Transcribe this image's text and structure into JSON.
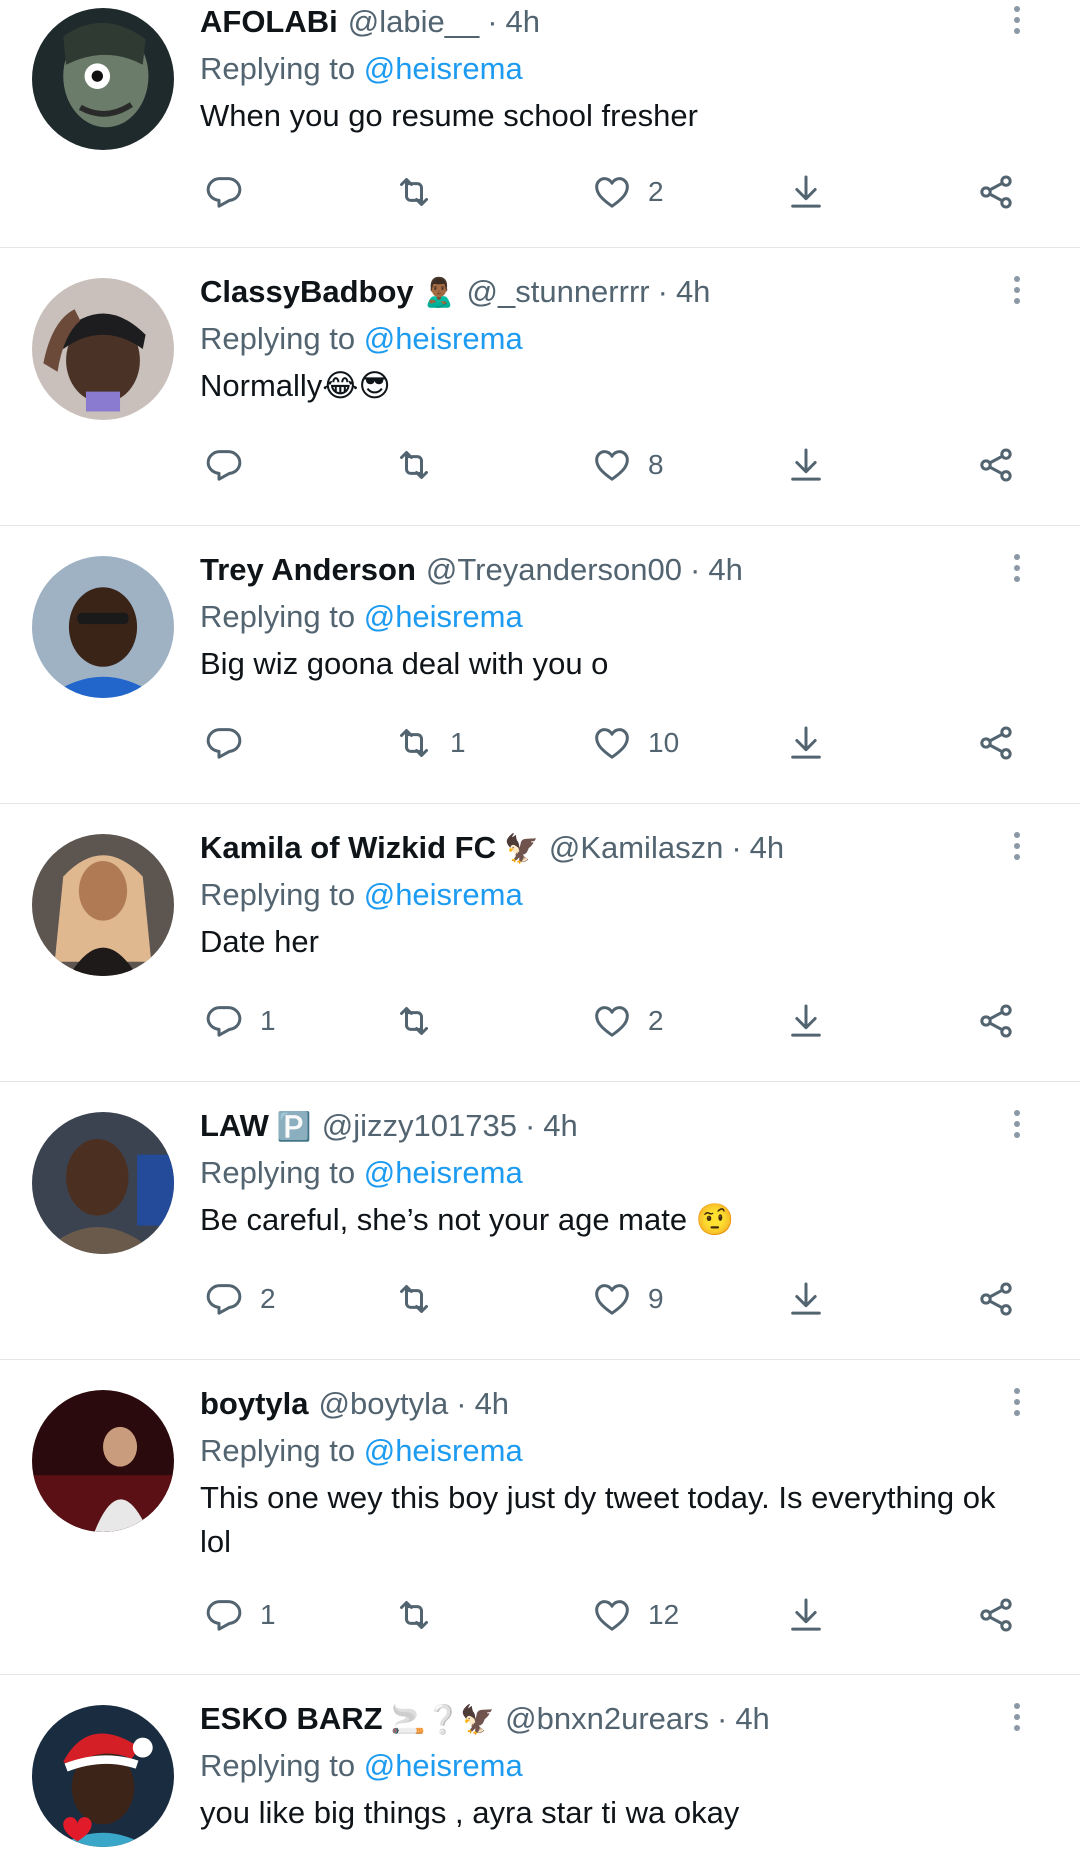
{
  "tweets": [
    {
      "name": "AFOLABi",
      "badge": "",
      "handle": "@labie__",
      "time": "4h",
      "replying_prefix": "Replying to",
      "replying_to": "@heisrema",
      "text": "When you go resume school fresher",
      "replies": "",
      "retweets": "",
      "likes": "2"
    },
    {
      "name": "ClassyBadboy",
      "badge": "🙎🏾‍♂️",
      "handle": "@_stunnerrrr",
      "time": "4h",
      "replying_prefix": "Replying to",
      "replying_to": "@heisrema",
      "text": "Normally😂😎",
      "replies": "",
      "retweets": "",
      "likes": "8"
    },
    {
      "name": "Trey Anderson",
      "badge": "",
      "handle": "@Treyanderson00",
      "time": "4h",
      "replying_prefix": "Replying to",
      "replying_to": "@heisrema",
      "text": "Big wiz goona deal with you o",
      "replies": "",
      "retweets": "1",
      "likes": "10"
    },
    {
      "name": "Kamila of Wizkid FC",
      "badge": "🦅",
      "handle": "@Kamilaszn",
      "time": "4h",
      "replying_prefix": "Replying to",
      "replying_to": "@heisrema",
      "text": "Date her",
      "replies": "1",
      "retweets": "",
      "likes": "2"
    },
    {
      "name": "LAW",
      "badge": "🅿️",
      "handle": "@jizzy101735",
      "time": "4h",
      "replying_prefix": "Replying to",
      "replying_to": "@heisrema",
      "text": "Be careful, she’s not your age mate 🤨",
      "replies": "2",
      "retweets": "",
      "likes": "9"
    },
    {
      "name": "boytyla",
      "badge": "",
      "handle": "@boytyla",
      "time": "4h",
      "replying_prefix": "Replying to",
      "replying_to": "@heisrema",
      "text": "This one wey this boy just dy tweet today. Is everything ok lol",
      "replies": "1",
      "retweets": "",
      "likes": "12"
    },
    {
      "name": "ESKO BARZ",
      "badge": "🚬❔🦅",
      "handle": "@bnxn2urears",
      "time": "4h",
      "replying_prefix": "Replying to",
      "replying_to": "@heisrema",
      "text": "you like big things , ayra star ti wa okay",
      "replies": "",
      "retweets": "",
      "likes": ""
    }
  ],
  "icons": {
    "reply": "reply-icon",
    "retweet": "retweet-icon",
    "like": "heart-icon",
    "download": "download-icon",
    "share": "share-icon",
    "more": "more-icon"
  },
  "colors": {
    "text": "#0f1419",
    "muted": "#536471",
    "link": "#1d9bf0",
    "divider": "#e3e6e8"
  }
}
